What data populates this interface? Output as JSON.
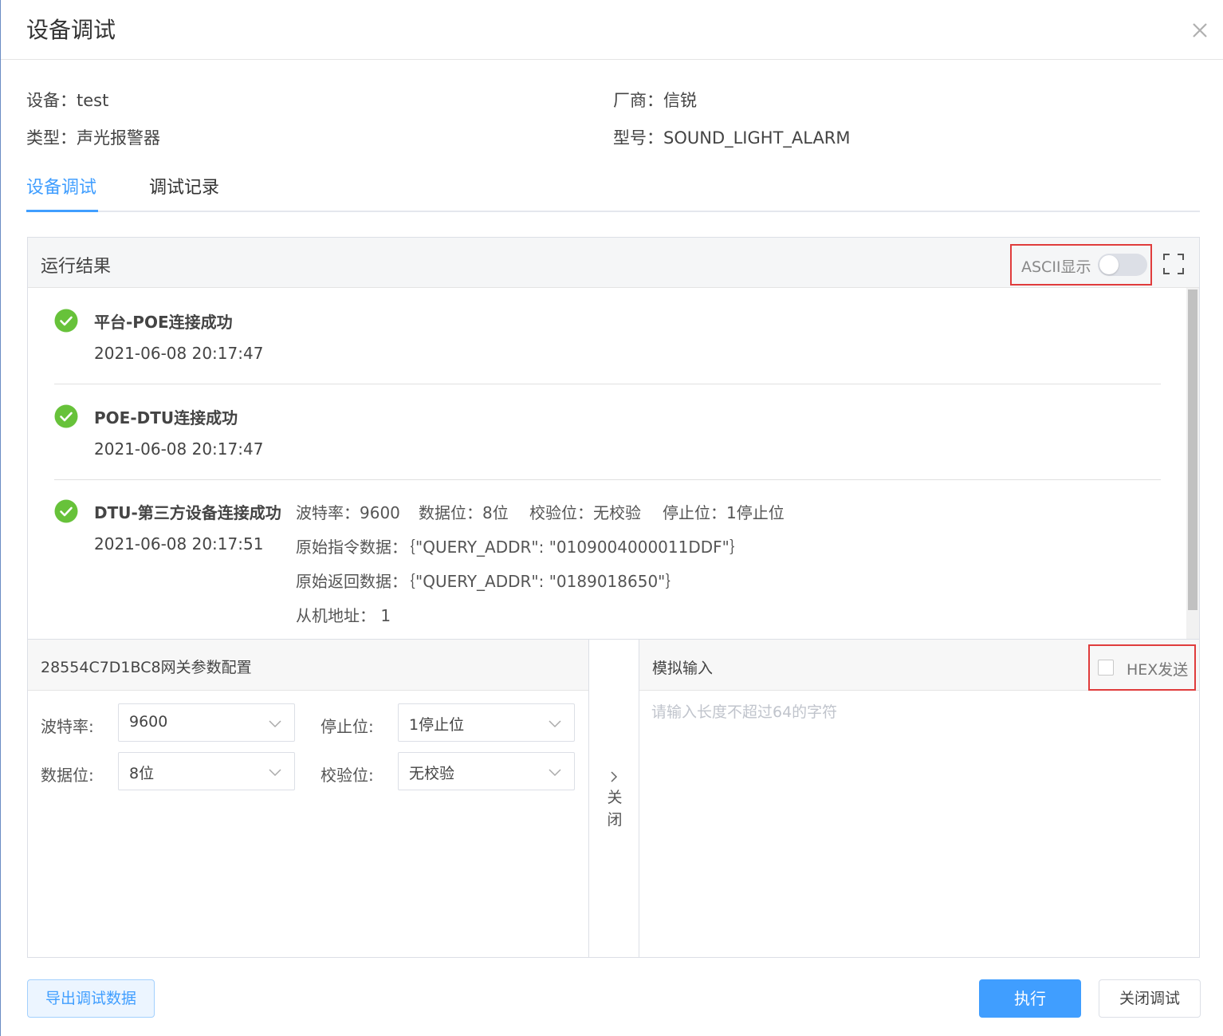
{
  "dialog": {
    "title": "设备调试"
  },
  "info": {
    "device_label": "设备：",
    "device_value": "test",
    "vendor_label": "厂商：",
    "vendor_value": "信锐",
    "type_label": "类型：",
    "type_value": "声光报警器",
    "model_label": "型号：",
    "model_value": "SOUND_LIGHT_ALARM"
  },
  "tabs": [
    {
      "label": "设备调试",
      "active": true
    },
    {
      "label": "调试记录",
      "active": false
    }
  ],
  "result": {
    "title": "运行结果",
    "ascii_label": "ASCII显示",
    "ascii_enabled": false,
    "logs": [
      {
        "title": "平台-POE连接成功",
        "time": "2021-06-08 20:17:47",
        "status": "success"
      },
      {
        "title": "POE-DTU连接成功",
        "time": "2021-06-08 20:17:47",
        "status": "success"
      },
      {
        "title": "DTU-第三方设备连接成功",
        "time": "2021-06-08 20:17:51",
        "status": "success",
        "baud": "波特率：9600",
        "databits": "数据位：8位",
        "parity": "校验位：无校验",
        "stopbits": "停止位：1停止位",
        "raw_cmd": "原始指令数据：｛\"QUERY_ADDR\": \"0109004000011DDF\"｝",
        "raw_resp": "原始返回数据：｛\"QUERY_ADDR\": \"0189018650\"｝",
        "slave_addr": "从机地址：  1"
      }
    ]
  },
  "config": {
    "title": "28554C7D1BC8网关参数配置",
    "baud_label": "波特率:",
    "baud_value": "9600",
    "stop_label": "停止位:",
    "stop_value": "1停止位",
    "databits_label": "数据位:",
    "databits_value": "8位",
    "parity_label": "校验位:",
    "parity_value": "无校验"
  },
  "collapse": {
    "label": "关闭"
  },
  "sim": {
    "title": "模拟输入",
    "hex_label": "HEX发送",
    "hex_checked": false,
    "placeholder": "请输入长度不超过64的字符"
  },
  "footer": {
    "export_label": "导出调试数据",
    "run_label": "执行",
    "close_label": "关闭调试"
  },
  "colors": {
    "primary": "#409eff",
    "success": "#67c23a",
    "highlight": "#e03c3c"
  }
}
